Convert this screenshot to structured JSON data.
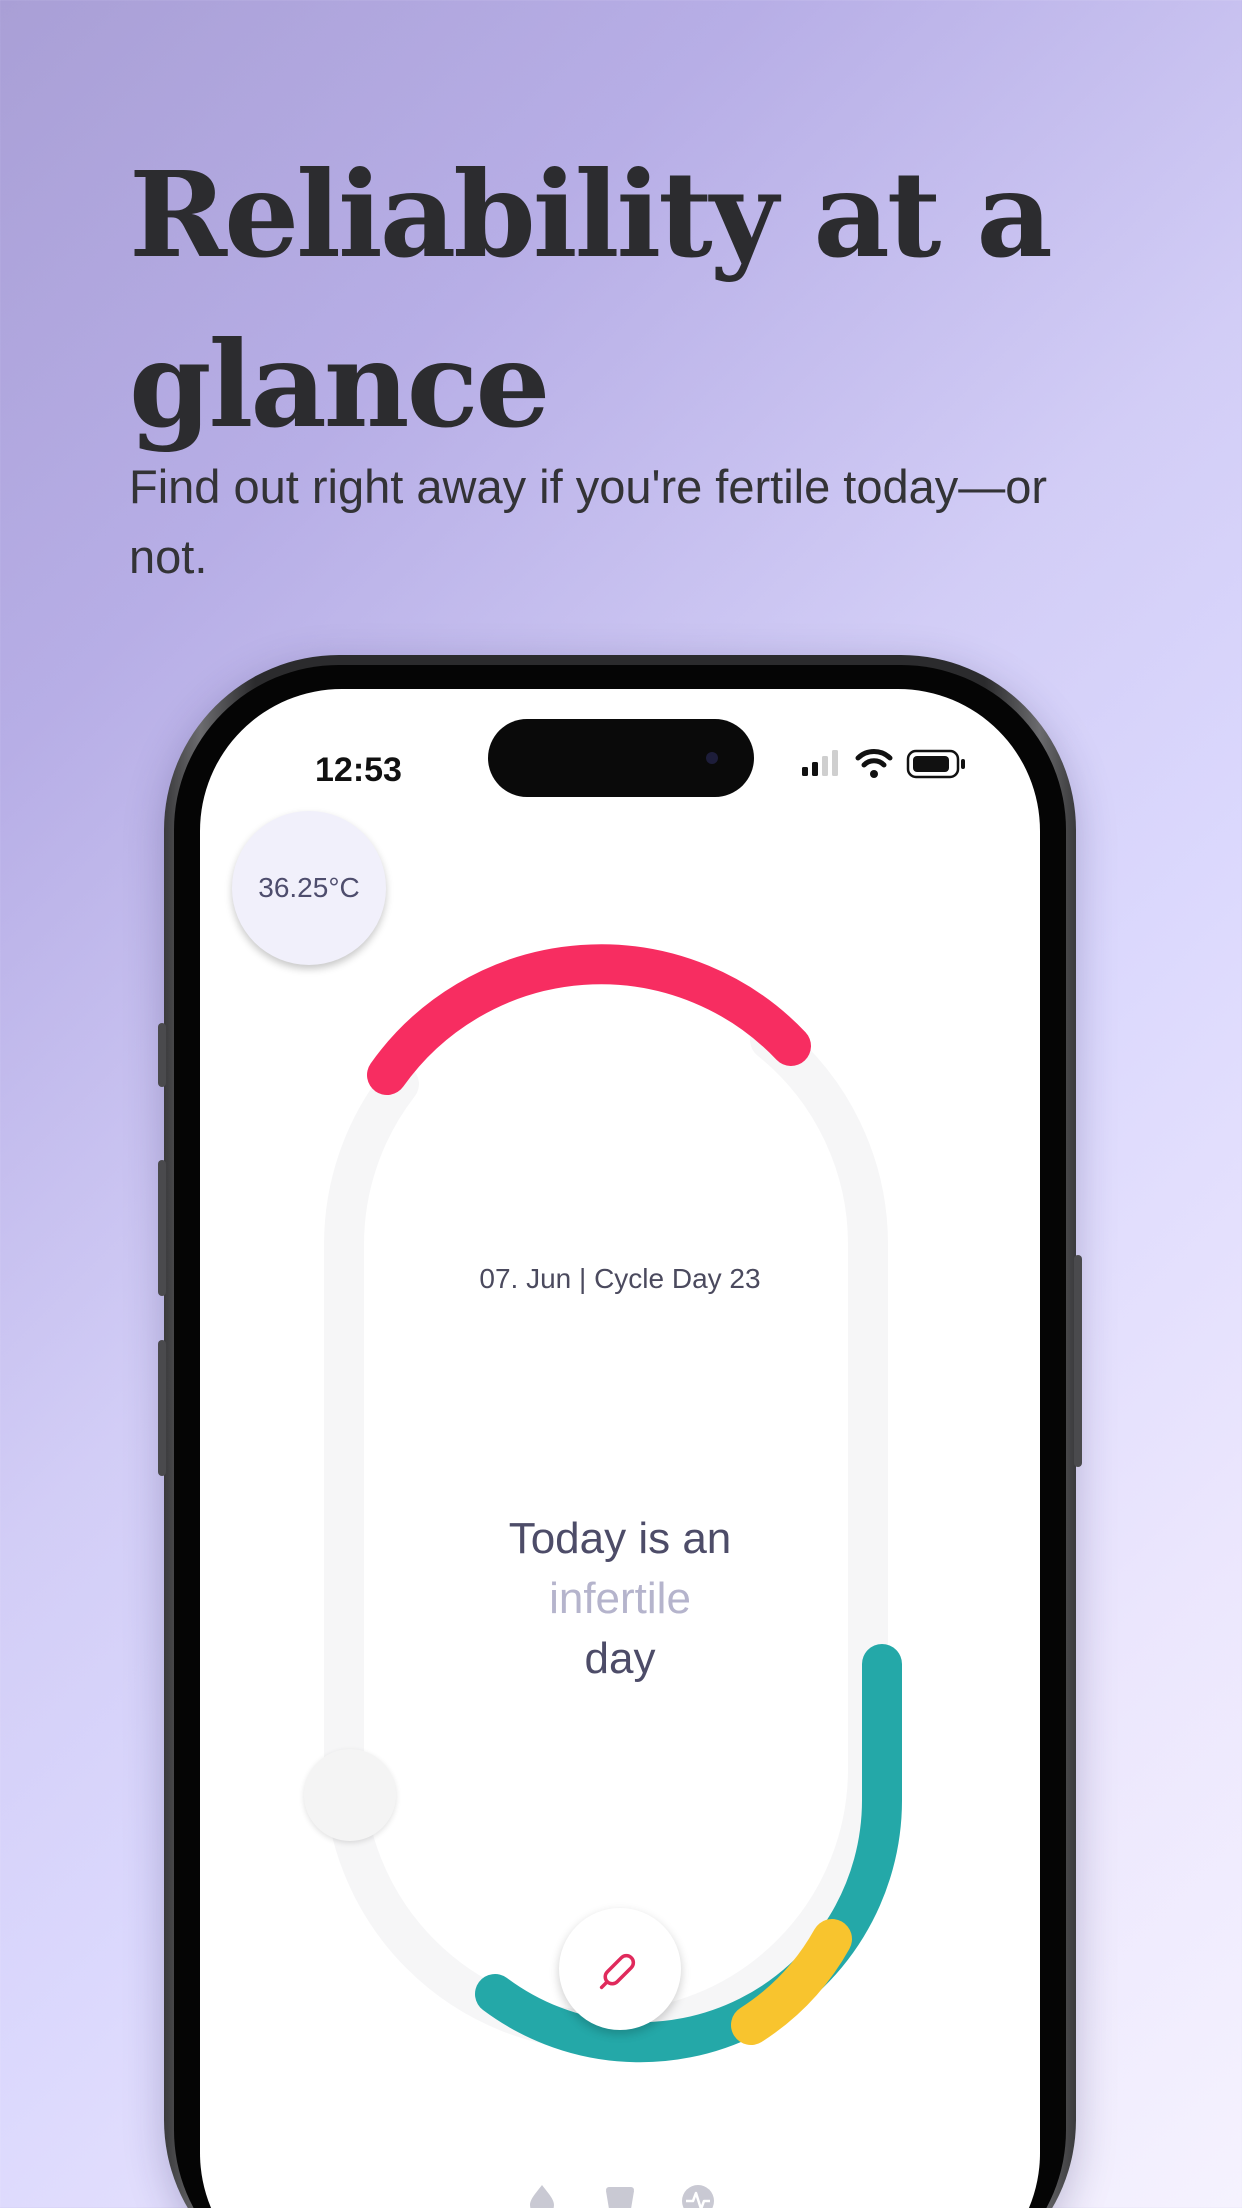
{
  "marketing": {
    "headline": "Reliability at a glance",
    "subheadline": "Find out right away if you're fertile today—or not."
  },
  "status_bar": {
    "time": "12:53",
    "icons": [
      "cellular-signal-icon",
      "wifi-icon",
      "battery-icon"
    ]
  },
  "app": {
    "temperature": "36.25°C",
    "date_line": "07. Jun | Cycle Day 23",
    "status": {
      "line1": "Today is an",
      "line2": "infertile",
      "line3": "day"
    },
    "edit_icon": "pencil-icon",
    "bottom_icons": [
      "drop-icon",
      "cup-icon",
      "pulse-icon"
    ]
  },
  "colors": {
    "fertile": "#f72d61",
    "infertile": "#24a8a8",
    "transition": "#f8c42e",
    "track": "#f6f6f7",
    "accent_text": "#b5b4cc"
  }
}
